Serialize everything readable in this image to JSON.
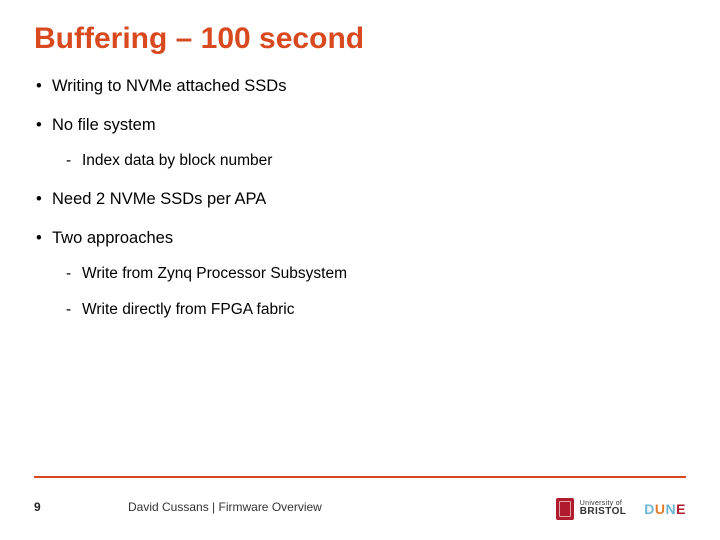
{
  "title": "Buffering – 100 second",
  "bullets": {
    "b0": "Writing to NVMe attached SSDs",
    "b1": "No file system",
    "b1_0": "Index data by block number",
    "b2": "Need 2 NVMe SSDs per APA",
    "b3": "Two approaches",
    "b3_0": "Write from Zynq Processor Subsystem",
    "b3_1": "Write directly from FPGA fabric"
  },
  "footer": {
    "page": "9",
    "credit": "David Cussans | Firmware Overview",
    "uob_upper": "University of",
    "uob_name": "BRISTOL",
    "dune": {
      "d": "D",
      "u": "U",
      "n": "N",
      "e": "E"
    }
  }
}
